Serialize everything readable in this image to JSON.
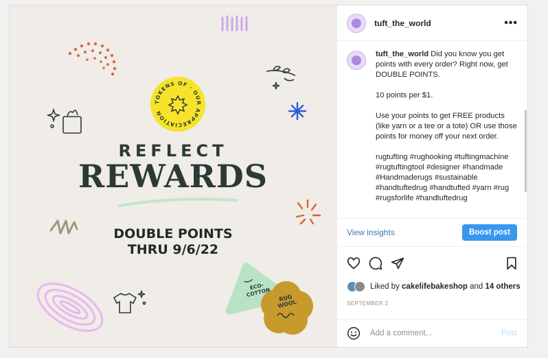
{
  "post": {
    "media": {
      "badge_text": "TOKENS OF · OUR APPRECIATION",
      "title_line1": "REFLECT",
      "title_line2": "REWARDS",
      "subtitle_line1": "DOUBLE POINTS",
      "subtitle_line2": "THRU 9/6/22",
      "sticker_green": "ECO-\nCOTTON",
      "sticker_mustard": "RUG\nWOOL"
    },
    "header": {
      "username": "tuft_the_world",
      "more_icon": "more-horizontal-icon"
    },
    "caption": {
      "username": "tuft_the_world",
      "text": " Did you know you get points with every order? Right now, get DOUBLE POINTS.\n\n10 points per $1.\n\nUse your points to get FREE products (like yarn or a tee or a tote) OR use those points for money off your next order.\n\nrugtufting #rughooking #tuftingmachine #rugtuftingtool #designer #handmade #Handmaderugs #sustainable #handtuftedrug #handtufted #yarn #rug #rugsforlife #handtuftedrug"
    },
    "insights": {
      "view_label": "View insights",
      "boost_label": "Boost post"
    },
    "likes": {
      "prefix": "Liked by ",
      "user": "cakelifebakeshop",
      "middle": " and ",
      "others": "14 others"
    },
    "date": "SEPTEMBER 2",
    "comment": {
      "placeholder": "Add a comment...",
      "post_label": "Post"
    },
    "colors": {
      "accent_blue": "#3897f0",
      "badge_yellow": "#f7e32a",
      "title_dark": "#2b3a37",
      "sticker_green": "#b7e3c4",
      "sticker_mustard": "#c79a2c"
    }
  }
}
